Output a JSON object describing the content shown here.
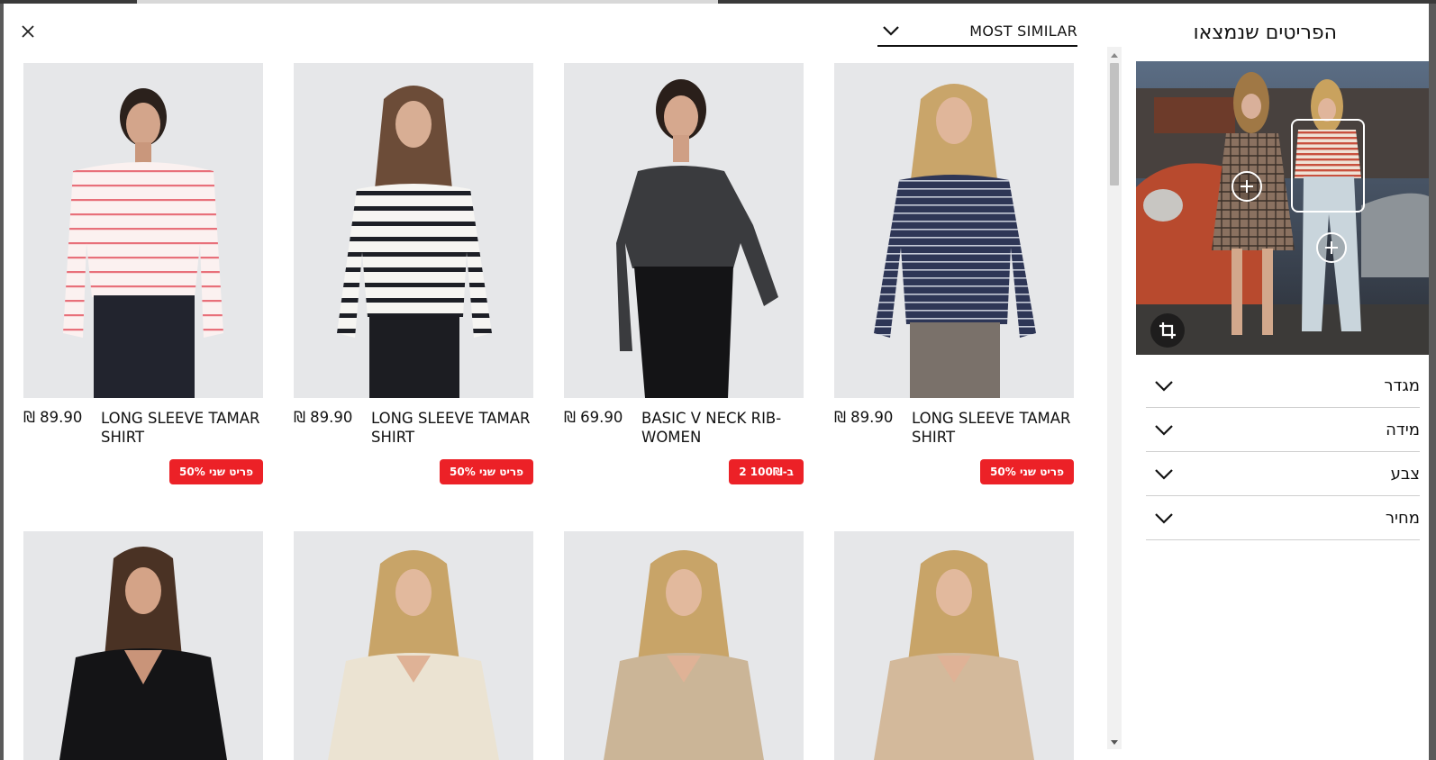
{
  "modal": {
    "close_label": "×",
    "sort": {
      "label": "MOST SIMILAR"
    },
    "products": [
      {
        "name": "LONG SLEEVE TAMAR SHIRT",
        "price": "₪ 89.90",
        "badge": "פריט שני 50%",
        "variant": "pink-stripe"
      },
      {
        "name": "LONG SLEEVE TAMAR SHIRT",
        "price": "₪ 89.90",
        "badge": "פריט שני 50%",
        "variant": "black-stripe"
      },
      {
        "name": "BASIC V NECK RIB-WOMEN",
        "price": "₪ 69.90",
        "badge": "2 ב-100₪",
        "variant": "charcoal"
      },
      {
        "name": "LONG SLEEVE TAMAR SHIRT",
        "price": "₪ 89.90",
        "badge": "פריט שני 50%",
        "variant": "navy-stripe"
      },
      {
        "name": "",
        "price": "",
        "badge": "",
        "variant": "black"
      },
      {
        "name": "",
        "price": "",
        "badge": "",
        "variant": "cream"
      },
      {
        "name": "",
        "price": "",
        "badge": "",
        "variant": "beige"
      },
      {
        "name": "",
        "price": "",
        "badge": "",
        "variant": "tan"
      }
    ]
  },
  "sidebar": {
    "title": "הפריטים שנמצאו",
    "filters": [
      {
        "label": "מגדר"
      },
      {
        "label": "מידה"
      },
      {
        "label": "צבע"
      },
      {
        "label": "מחיר"
      }
    ]
  },
  "colors": {
    "badge_red": "#ec2127",
    "photo_bg": "#e6e7e9"
  }
}
